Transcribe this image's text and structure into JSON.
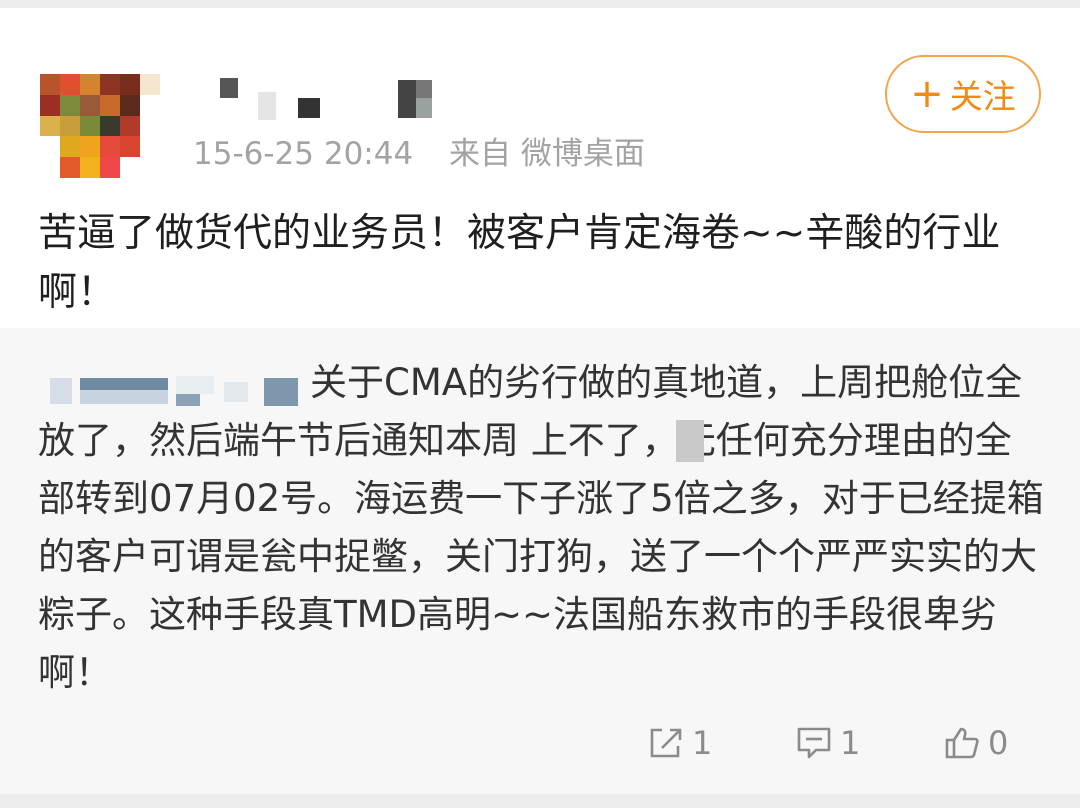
{
  "post": {
    "timestamp": "15-6-25 20:44",
    "source": "来自 微博桌面",
    "follow_label": "关注",
    "text": "苦逼了做货代的业务员！被客户肯定海卷~~辛酸的行业啊！"
  },
  "repost": {
    "text": "关于CMA的劣行做的真地道，上周把舱位全放了，然后端午节后通知本周 上不了，无任何充分理由的全部转到07月02号。海运费一下子涨了5倍之多，对于已经提箱的客户可谓是瓮中捉鳖，关门打狗，送了一个个严严实实的大粽子。这种手段真TMD高明~~法国船东救市的手段很卑劣啊！"
  },
  "actions": {
    "forward_count": "1",
    "comment_count": "1",
    "like_count": "0"
  },
  "colors": {
    "accent": "#ef8a12",
    "follow_border": "#f0a64a",
    "meta_text": "#a3a3a3",
    "repost_bg": "#f7f7f7"
  },
  "icons": {
    "forward": "forward-icon",
    "comment": "comment-icon",
    "like": "thumbs-up-icon"
  }
}
